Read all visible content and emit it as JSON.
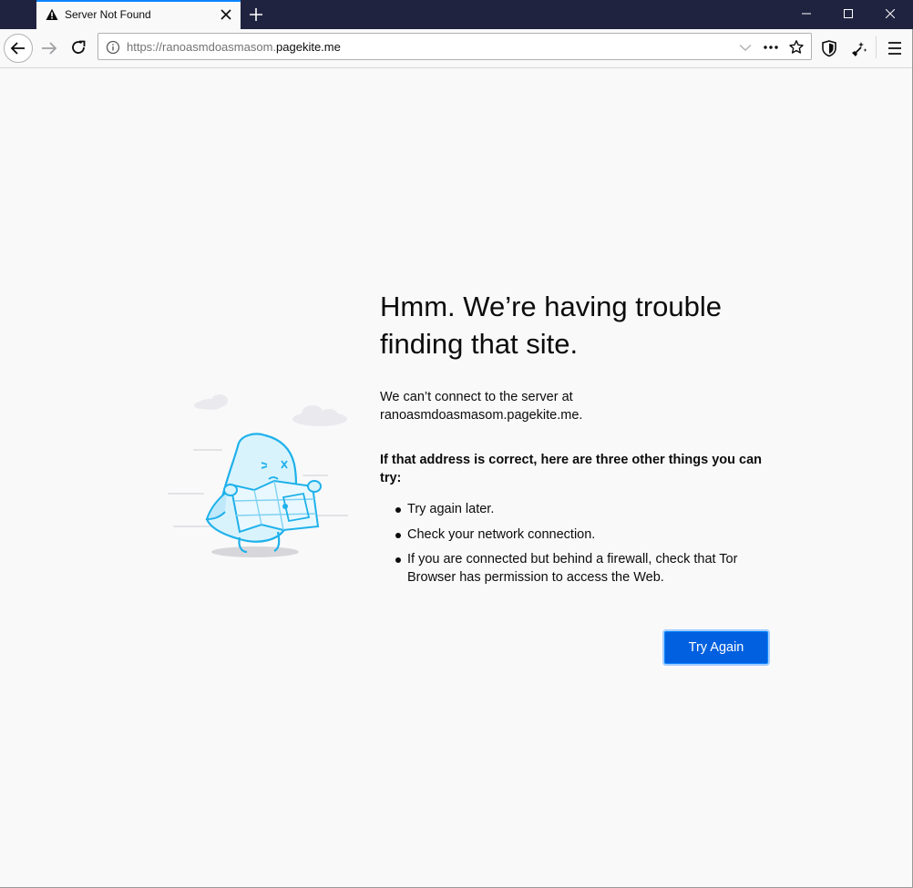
{
  "tab": {
    "title": "Server Not Found"
  },
  "url": {
    "prefix": "https://ranoasmdoasmasom.",
    "domain": "pagekite.me"
  },
  "error": {
    "title_line1": "Hmm. We’re having trouble",
    "title_line2": "finding that site.",
    "desc_line1": "We can’t connect to the server at",
    "desc_line2": "ranoasmdoasmasom.pagekite.me.",
    "subhead": "If that address is correct, here are three other things you can try:",
    "items": [
      {
        "text": "Try again later."
      },
      {
        "text": "Check your network connection."
      },
      {
        "text": "If you are connected but behind a firewall, check that Tor Browser has permission to access the Web."
      }
    ],
    "button_label": "Try Again"
  },
  "colors": {
    "tabstrip": "#202340",
    "accent": "#0a84ff",
    "button": "#0060df",
    "background": "#f9f9fa"
  }
}
